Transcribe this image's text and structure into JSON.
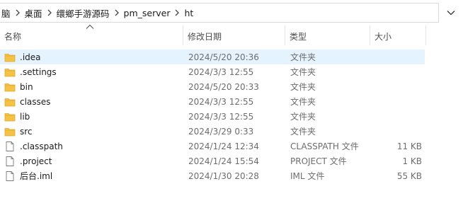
{
  "breadcrumb": {
    "items": [
      "脑",
      "桌面",
      "缳鄉手游源码",
      "pm_server",
      "ht"
    ]
  },
  "columns": {
    "name": "名称",
    "date": "修改日期",
    "type": "类型",
    "size": "大小"
  },
  "files": [
    {
      "name": ".idea",
      "date": "2024/5/20 20:36",
      "type": "文件夹",
      "size": "",
      "icon": "folder-icon",
      "selected": true
    },
    {
      "name": ".settings",
      "date": "2024/3/3 12:55",
      "type": "文件夹",
      "size": "",
      "icon": "folder-icon",
      "selected": false
    },
    {
      "name": "bin",
      "date": "2024/5/20 20:33",
      "type": "文件夹",
      "size": "",
      "icon": "folder-icon",
      "selected": false
    },
    {
      "name": "classes",
      "date": "2024/3/3 12:55",
      "type": "文件夹",
      "size": "",
      "icon": "folder-icon",
      "selected": false
    },
    {
      "name": "lib",
      "date": "2024/3/3 12:55",
      "type": "文件夹",
      "size": "",
      "icon": "folder-icon",
      "selected": false
    },
    {
      "name": "src",
      "date": "2024/3/29 0:33",
      "type": "文件夹",
      "size": "",
      "icon": "folder-icon",
      "selected": false
    },
    {
      "name": ".classpath",
      "date": "2024/1/24 12:34",
      "type": "CLASSPATH 文件",
      "size": "11 KB",
      "icon": "file-icon",
      "selected": false
    },
    {
      "name": ".project",
      "date": "2024/1/24 15:54",
      "type": "PROJECT 文件",
      "size": "1 KB",
      "icon": "file-icon",
      "selected": false
    },
    {
      "name": "后台.iml",
      "date": "2024/1/30 20:28",
      "type": "IML 文件",
      "size": "55 KB",
      "icon": "file-icon",
      "selected": false
    }
  ],
  "colors": {
    "folder": "#f4c245",
    "folder_dark": "#e0a82e",
    "selected_row": "#e5f3ff"
  }
}
